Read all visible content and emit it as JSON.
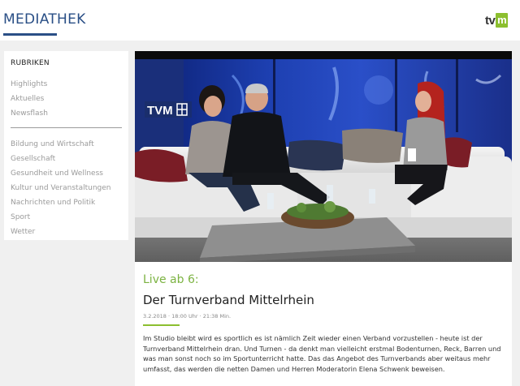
{
  "header": {
    "title": "MEDIATHEK",
    "logo": {
      "text": "tv",
      "mark": "m",
      "accent": "#8cbf2f"
    }
  },
  "sidebar": {
    "heading": "RUBRIKEN",
    "group1": [
      "Highlights",
      "Aktuelles",
      "Newsflash"
    ],
    "group2": [
      "Bildung und Wirtschaft",
      "Gesellschaft",
      "Gesundheit und Wellness",
      "Kultur und Veranstaltungen",
      "Nachrichten und Politik",
      "Sport",
      "Wetter"
    ]
  },
  "video": {
    "studio_logo": "TVM"
  },
  "article": {
    "live_label": "Live ab 6:",
    "title": "Der Turnverband Mittelrhein",
    "meta": "3.2.2018 · 18:00 Uhr · 21:38 Min.",
    "description": "Im Studio bleibt wird es sportlich es ist nämlich Zeit wieder einen Verband vorzustellen - heute ist der Turnverband Mittelrhein dran. Und Turnen - da denkt man vielleicht erstmal Bodenturnen, Reck, Barren und was man sonst noch so im Sportunterricht hatte. Das das Angebot des Turnverbands aber weitaus mehr umfasst, das werden die netten Damen und Herren Moderatorin Elena Schwenk beweisen."
  },
  "colors": {
    "brand_blue": "#2a4f86",
    "accent_green": "#8cbf2f",
    "live_green": "#7cb342"
  }
}
